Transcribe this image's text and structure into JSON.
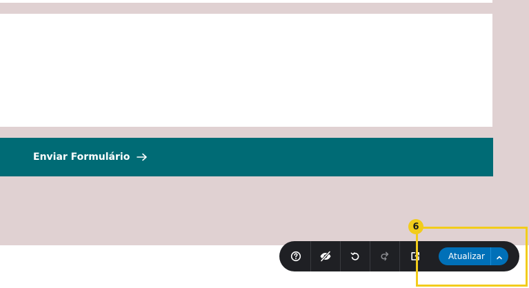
{
  "form": {
    "submit_label": "Enviar Formulário",
    "submit_icon": "arrow-right-icon"
  },
  "toolbar": {
    "icons": [
      "help-icon",
      "eye-off-icon",
      "undo-icon",
      "redo-icon",
      "external-link-icon"
    ],
    "update_label": "Atualizar",
    "update_menu_icon": "chevron-up-icon"
  },
  "annotation": {
    "step_number": "6"
  },
  "colors": {
    "section_background": "#e0d1d2",
    "submit_button": "#006b75",
    "toolbar_background": "#1f2024",
    "update_button": "#0070b8",
    "highlight": "#f2cc1b"
  }
}
